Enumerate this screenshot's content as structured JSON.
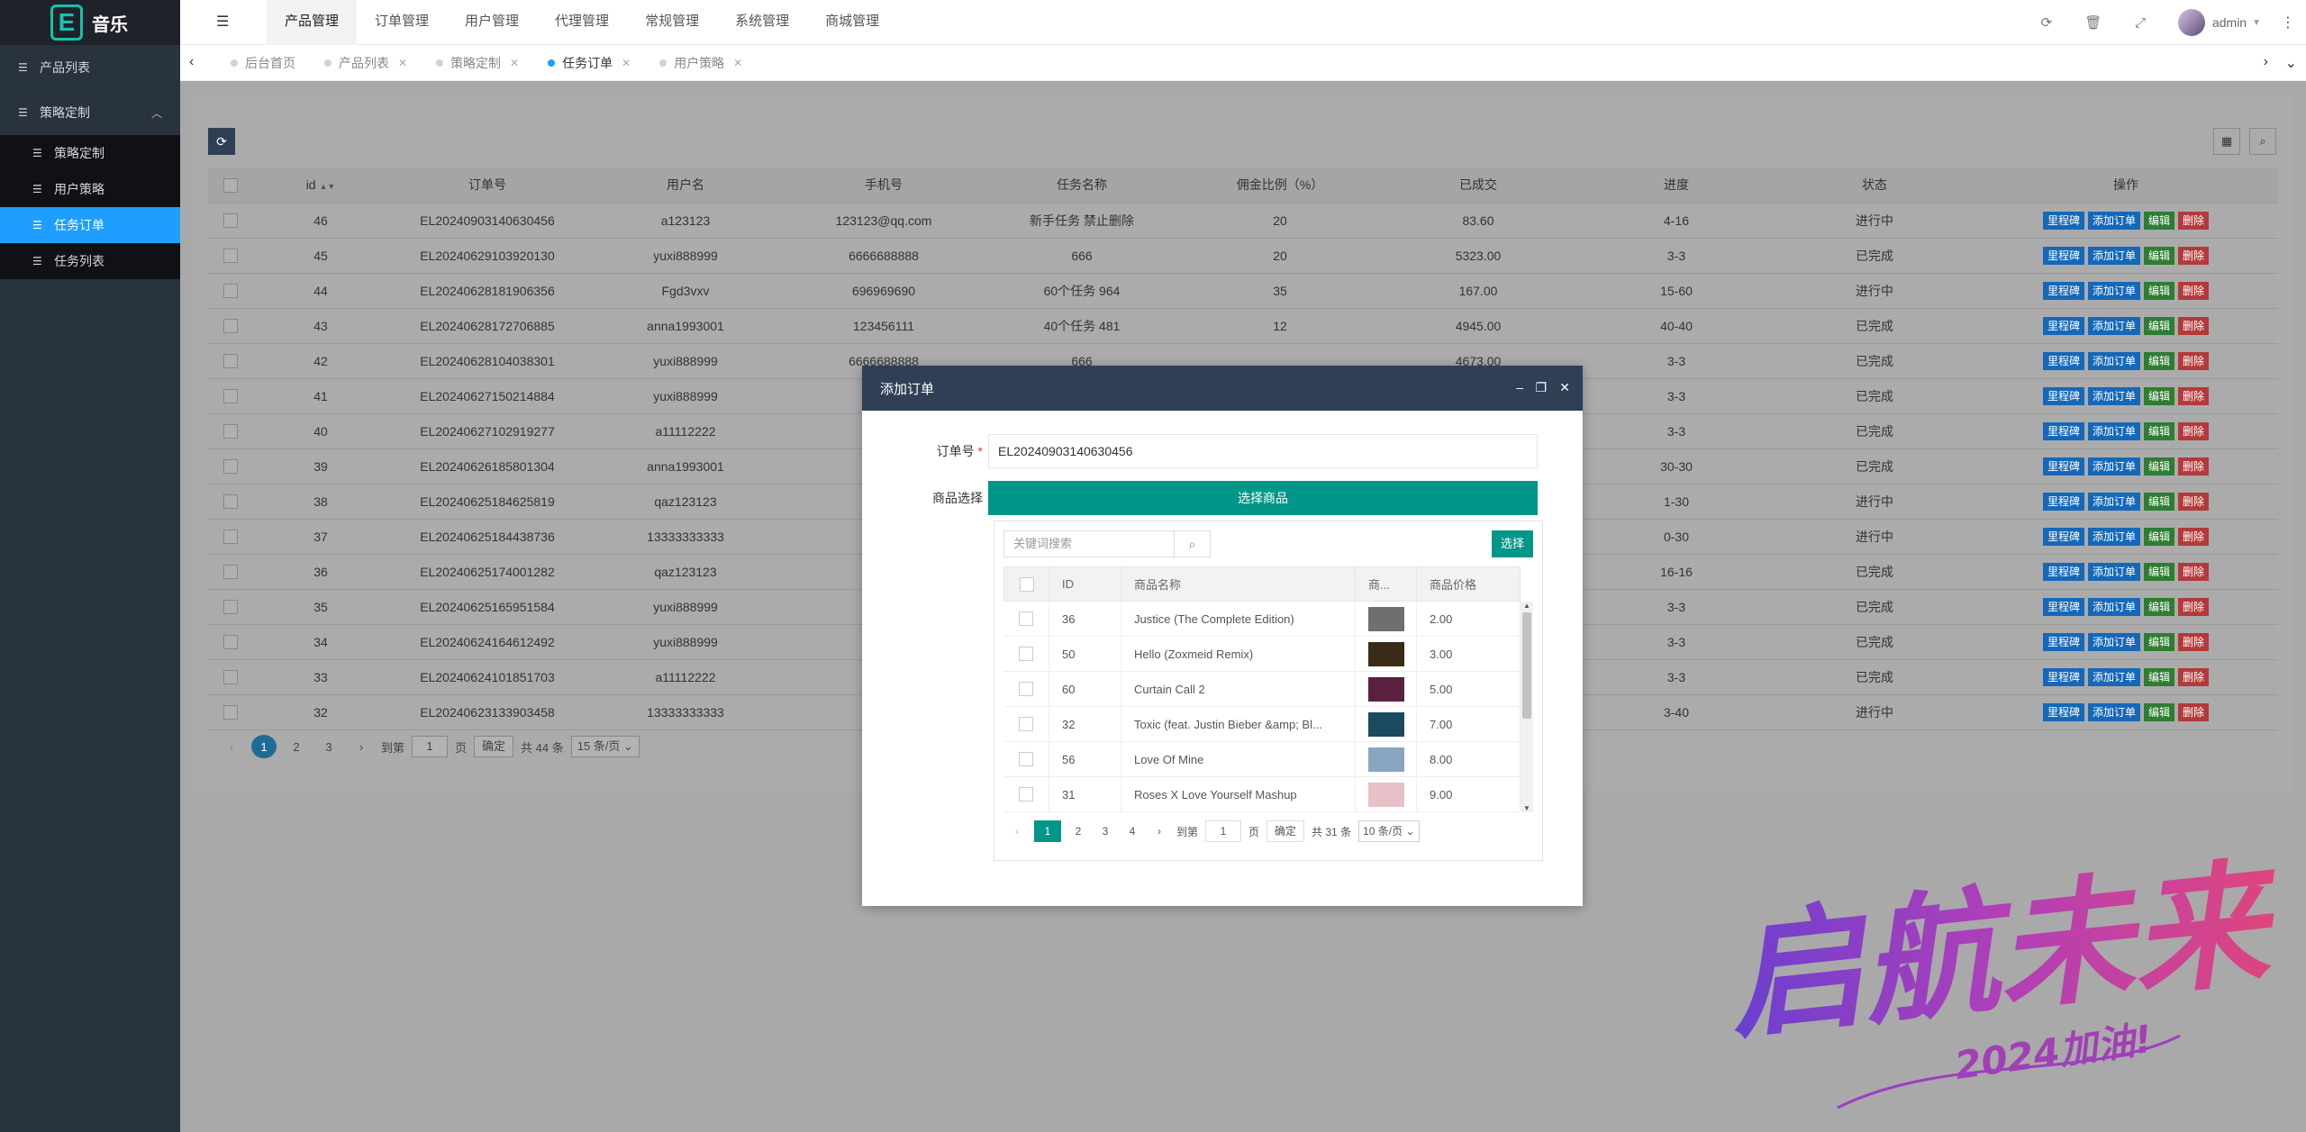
{
  "app": {
    "logo_letter": "E",
    "title": "音乐"
  },
  "sidebar": {
    "items": [
      {
        "label": "产品列表"
      },
      {
        "label": "策略定制"
      }
    ],
    "sub_items": [
      {
        "label": "策略定制"
      },
      {
        "label": "用户策略"
      },
      {
        "label": "任务订单"
      },
      {
        "label": "任务列表"
      }
    ]
  },
  "topnav": [
    "产品管理",
    "订单管理",
    "用户管理",
    "代理管理",
    "常规管理",
    "系统管理",
    "商城管理"
  ],
  "user": {
    "name": "admin"
  },
  "tabs": [
    "后台首页",
    "产品列表",
    "策略定制",
    "任务订单",
    "用户策略"
  ],
  "table": {
    "headers": [
      "id",
      "订单号",
      "用户名",
      "手机号",
      "任务名称",
      "佣金比例（%）",
      "已成交",
      "进度",
      "状态",
      "操作"
    ],
    "rows": [
      [
        "46",
        "EL20240903140630456",
        "a123123",
        "123123@qq.com",
        "新手任务 禁止删除",
        "20",
        "83.60",
        "4-16",
        "进行中"
      ],
      [
        "45",
        "EL20240629103920130",
        "yuxi888999",
        "6666688888",
        "666",
        "20",
        "5323.00",
        "3-3",
        "已完成"
      ],
      [
        "44",
        "EL20240628181906356",
        "Fgd3vxv",
        "696969690",
        "60个任务 964",
        "35",
        "167.00",
        "15-60",
        "进行中"
      ],
      [
        "43",
        "EL20240628172706885",
        "anna1993001",
        "123456111",
        "40个任务 481",
        "12",
        "4945.00",
        "40-40",
        "已完成"
      ],
      [
        "42",
        "EL20240628104038301",
        "yuxi888999",
        "6666688888",
        "666",
        "",
        "4673.00",
        "3-3",
        "已完成"
      ],
      [
        "41",
        "EL20240627150214884",
        "yuxi888999",
        "",
        "",
        "",
        "",
        "3-3",
        "已完成"
      ],
      [
        "40",
        "EL20240627102919277",
        "a11112222",
        "",
        "",
        "",
        "",
        "3-3",
        "已完成"
      ],
      [
        "39",
        "EL20240626185801304",
        "anna1993001",
        "",
        "",
        "",
        "",
        "30-30",
        "已完成"
      ],
      [
        "38",
        "EL20240625184625819",
        "qaz123123",
        "",
        "",
        "",
        "",
        "1-30",
        "进行中"
      ],
      [
        "37",
        "EL20240625184438736",
        "13333333333",
        "",
        "",
        "",
        "",
        "0-30",
        "进行中"
      ],
      [
        "36",
        "EL20240625174001282",
        "qaz123123",
        "",
        "",
        "",
        "",
        "16-16",
        "已完成"
      ],
      [
        "35",
        "EL20240625165951584",
        "yuxi888999",
        "",
        "",
        "",
        "",
        "3-3",
        "已完成"
      ],
      [
        "34",
        "EL20240624164612492",
        "yuxi888999",
        "",
        "",
        "",
        "",
        "3-3",
        "已完成"
      ],
      [
        "33",
        "EL20240624101851703",
        "a11112222",
        "",
        "",
        "",
        "",
        "3-3",
        "已完成"
      ],
      [
        "32",
        "EL20240623133903458",
        "13333333333",
        "",
        "",
        "",
        "",
        "3-40",
        "进行中"
      ]
    ],
    "op_labels": [
      "里程碑",
      "添加订单",
      "编辑",
      "删除"
    ]
  },
  "pager": {
    "pages": [
      "1",
      "2",
      "3"
    ],
    "goto_label": "到第",
    "goto_value": "1",
    "page_unit": "页",
    "confirm": "确定",
    "total": "共 44 条",
    "per_page": "15 条/页"
  },
  "modal": {
    "title": "添加订单",
    "order_label": "订单号",
    "required_mark": "*",
    "order_value": "EL20240903140630456",
    "product_label": "商品选择",
    "pick_button": "选择商品",
    "search_placeholder": "关键词搜索",
    "choose_button": "选择",
    "headers": [
      "ID",
      "商品名称",
      "商...",
      "商品价格"
    ],
    "rows": [
      [
        "36",
        "Justice (The Complete Edition)",
        "2.00"
      ],
      [
        "50",
        "Hello (Zoxmeid Remix)",
        "3.00"
      ],
      [
        "60",
        "Curtain Call 2",
        "5.00"
      ],
      [
        "32",
        "Toxic (feat. Justin Bieber &amp; Bl...",
        "7.00"
      ],
      [
        "56",
        "Love Of Mine",
        "8.00"
      ],
      [
        "31",
        "Roses X Love Yourself Mashup",
        "9.00"
      ]
    ],
    "pager": {
      "pages": [
        "1",
        "2",
        "3",
        "4"
      ],
      "goto_label": "到第",
      "goto_value": "1",
      "page_unit": "页",
      "confirm": "确定",
      "total": "共 31 条",
      "per_page": "10 条/页"
    }
  },
  "watermark": {
    "text": "启航未来",
    "sub": "2024加油!"
  },
  "colors": {
    "accent": "#1e9fff",
    "teal": "#009688",
    "dark": "#2f4056"
  }
}
